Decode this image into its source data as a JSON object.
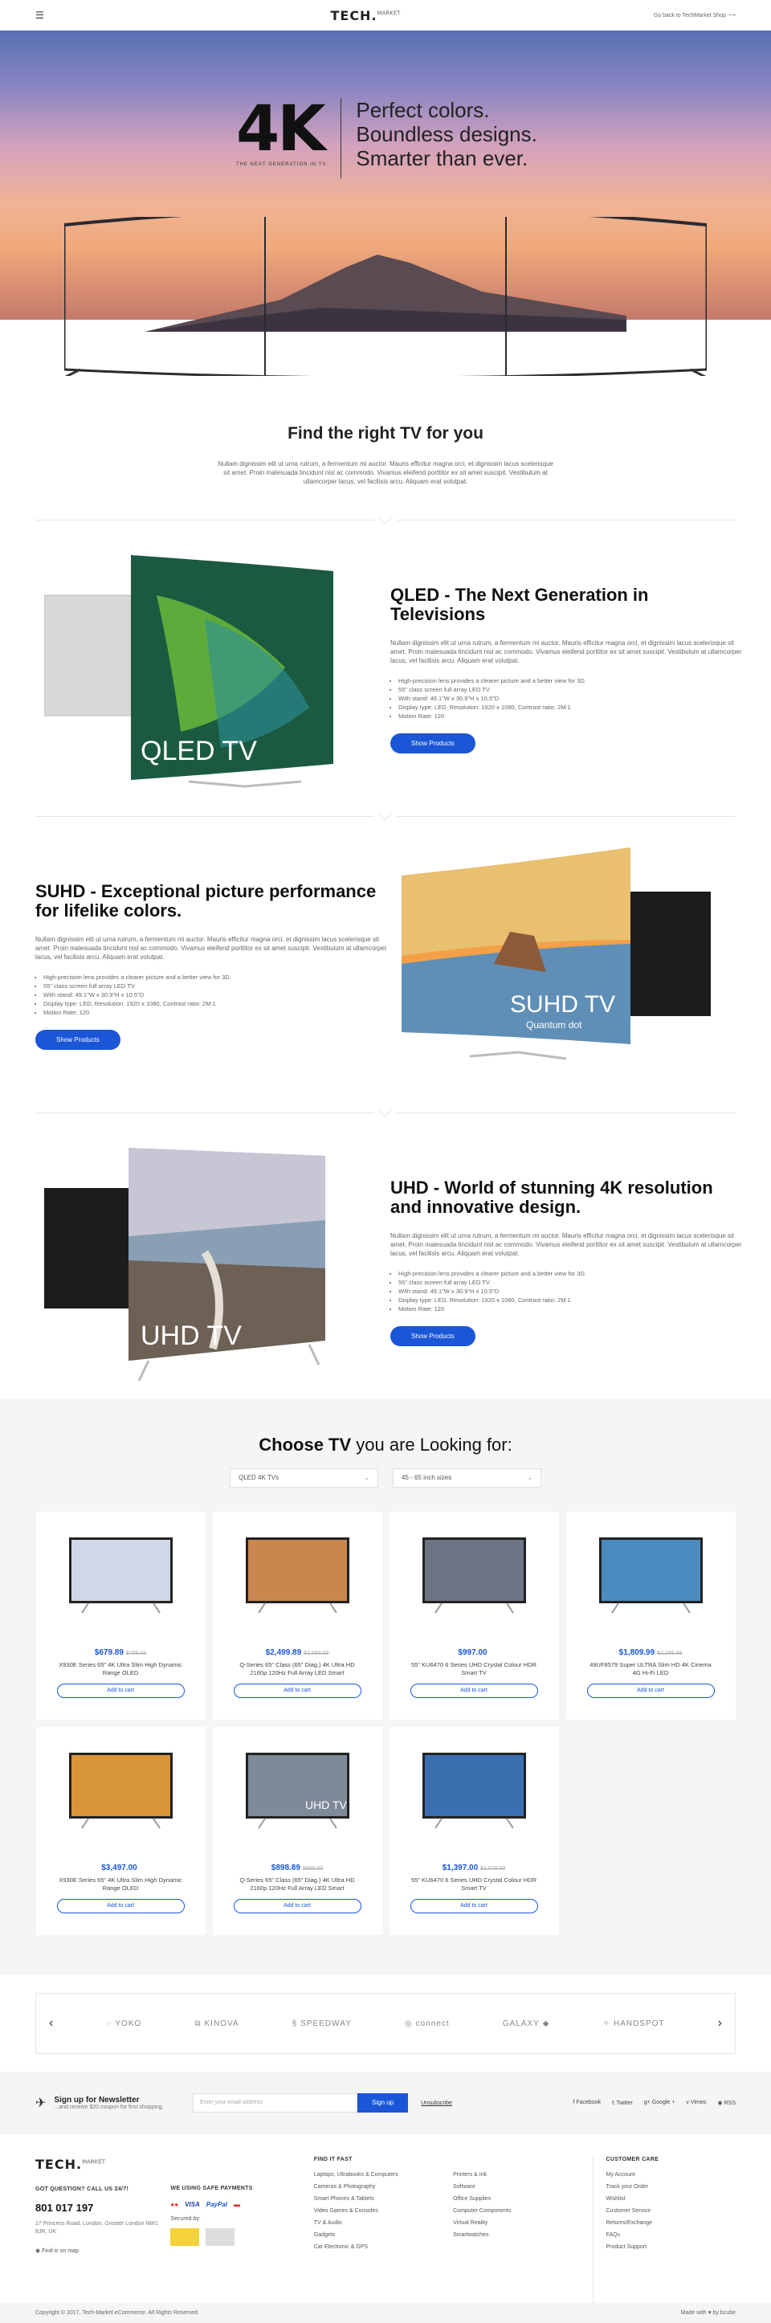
{
  "header": {
    "logo_main": "TECH.",
    "logo_sup": "MARKET",
    "back_link": "Go back to TechMarket Shop"
  },
  "hero": {
    "big": "4K",
    "small": "THE NEXT GENERATION IN TV",
    "tagline_1": "Perfect colors.",
    "tagline_2": "Boundless designs.",
    "tagline_3": "Smarter than ever."
  },
  "intro": {
    "title": "Find the right TV for you",
    "text": "Nullam dignissim elit ut urna rutrum, a fermentum mi auctor. Mauris efficitur magna orci, et dignissim lacus scelerisque sit amet. Proin malesuada tincidunt nisl ac commodo. Vivamus eleifend porttitor ex sit amet suscipit. Vestibulum at ullamcorper lacus, vel facilisis arcu. Aliquam erat volutpat."
  },
  "features": [
    {
      "title": "QLED - The Next Generation in Televisions",
      "text": "Nullam dignissim elit ut urna rutrum, a fermentum mi auctor. Mauris efficitur magna orci, et dignissim lacus scelerisque sit amet. Proin malesuada tincidunt nisl ac commodo. Vivamus eleifend porttitor ex sit amet suscipit. Vestibulum at ullamcorper lacus, vel facilisis arcu. Aliquam erat volutpat.",
      "bullets": [
        "High-precision lens provides a clearer picture and a better view for 3D.",
        "55\" class screen full array LED TV",
        "With stand: 49.1\"W x 30.9\"H x 10.5\"D",
        "Display type: LED, Resolution: 1920 x 1080, Contrast ratio: 2M:1",
        "Motion Rate: 120"
      ],
      "button": "Show Products",
      "tv_label": "QLED TV"
    },
    {
      "title": "SUHD - Exceptional picture performance for lifelike colors.",
      "text": "Nullam dignissim elit ut urna rutrum, a fermentum mi auctor. Mauris efficitur magna orci, et dignissim lacus scelerisque sit amet. Proin malesuada tincidunt nisl ac commodo. Vivamus eleifend porttitor ex sit amet suscipit. Vestibulum at ullamcorper lacus, vel facilisis arcu. Aliquam erat volutpat.",
      "bullets": [
        "High-precision lens provides a clearer picture and a better view for 3D.",
        "55\" class screen full array LED TV",
        "With stand: 49.1\"W x 30.9\"H x 10.5\"D",
        "Display type: LED, Resolution: 1920 x 1080, Contrast ratio: 2M:1",
        "Motion Rate: 120"
      ],
      "button": "Show Products",
      "tv_label": "SUHD TV",
      "tv_sub": "Quantum dot"
    },
    {
      "title": "UHD - World of stunning 4K resolution and innovative design.",
      "text": "Nullam dignissim elit ut urna rutrum, a fermentum mi auctor. Mauris efficitur magna orci, et dignissim lacus scelerisque sit amet. Proin malesuada tincidunt nisl ac commodo. Vivamus eleifend porttitor ex sit amet suscipit. Vestibulum at ullamcorper lacus, vel facilisis arcu. Aliquam erat volutpat.",
      "bullets": [
        "High-precision lens provides a clearer picture and a better view for 3D.",
        "55\" class screen full array LED TV",
        "With stand: 49.1\"W x 30.9\"H x 10.5\"D",
        "Display type: LED, Resolution: 1920 x 1080, Contrast ratio: 2M:1",
        "Motion Rate: 120"
      ],
      "button": "Show Products",
      "tv_label": "UHD TV"
    }
  ],
  "finder": {
    "title_bold": "Choose TV",
    "title_rest": " you are Looking for:",
    "select_1": "QLED 4K TVs",
    "select_2": "45 - 65 inch sizes"
  },
  "products": [
    {
      "price": "$679.89",
      "old": "$789.00",
      "name": "X930E Series 65\" 4K Ultra Slim High Dynamic Range OLED",
      "button": "Add to cart",
      "screen": "#cfd8e6"
    },
    {
      "price": "$2,499.89",
      "old": "$2,599.00",
      "name": "Q-Series 65\" Class (65\" Diag.) 4K Ultra HD 2160p 120Hz Full Array LED Smart",
      "button": "Add to cart",
      "screen": "#c8874f"
    },
    {
      "price": "$997.00",
      "old": "",
      "name": "55\" KU6470 6 Series UHD Crystal Colour HDR Smart TV",
      "button": "Add to cart",
      "screen": "#6b7583"
    },
    {
      "price": "$1,809.99",
      "old": "$2,189.99",
      "name": "49UF8579 Super ULTRA Slim HD 4K Cinema 4G Hi-Fi LED",
      "button": "Add to cart",
      "screen": "#4a8cc0"
    },
    {
      "price": "$3,497.00",
      "old": "",
      "name": "X930E Series 65\" 4K Ultra Slim High Dynamic Range OLED",
      "button": "Add to cart",
      "screen": "#d9953a"
    },
    {
      "price": "$898.89",
      "old": "$989.00",
      "name": "Q-Series 65\" Class (65\" Diag.) 4K Ultra HD 2160p 120Hz Full Array LED Smart",
      "button": "Add to cart",
      "screen": "#7e8a98",
      "tv_label": "UHD TV"
    },
    {
      "price": "$1,397.00",
      "old": "$1,529.00",
      "name": "55\" KU6470 6 Series UHD Crystal Colour HDR Smart TV",
      "button": "Add to cart",
      "screen": "#3a6fb0"
    }
  ],
  "brands": [
    "YOKO",
    "KINOVA",
    "SPEEDWAY",
    "connect",
    "GALAXY",
    "HANDSPOT"
  ],
  "newsletter": {
    "title": "Sign up for Newsletter",
    "sub": "...and receive $20 coupon for first shopping.",
    "placeholder": "Enter your email address",
    "button": "Sign up",
    "unsubscribe": "Unsubscribe",
    "socials": [
      "Facebook",
      "Twitter",
      "Google +",
      "Vimeo",
      "RSS"
    ]
  },
  "footer": {
    "logo_main": "TECH.",
    "logo_sup": "MARKET",
    "question": "GOT QUESTION? CALL US 24/7!",
    "phone": "801 017 197",
    "address": "17 Princess Road, London, Greater London NW1 8JR, UK",
    "map": "Find is on map",
    "safe_title": "WE USING SAFE PAYMENTS",
    "payments": [
      "VISA",
      "PayPal"
    ],
    "secured": "Secured by:",
    "find_title": "FIND IT FAST",
    "find_col1": [
      "Laptops, Ultrabooks & Computers",
      "Cameras & Photography",
      "Smart Phones & Tablets",
      "Video Games & Consoles",
      "TV & Audio",
      "Gadgets",
      "Car Electronic & GPS"
    ],
    "find_col2": [
      "Printers & Ink",
      "Software",
      "Office Supplies",
      "Computer Components",
      "Virtual Reality",
      "Smartwatches"
    ],
    "care_title": "CUSTOMER CARE",
    "care": [
      "My Account",
      "Track your Order",
      "Wishlist",
      "Customer Service",
      "Returns/Exchange",
      "FAQs",
      "Product Support"
    ],
    "copyright": "Copyright © 2017, Tech-Market eCommerce. All Rights Reserved.",
    "made_with": "Made with ♥ by bcube"
  }
}
